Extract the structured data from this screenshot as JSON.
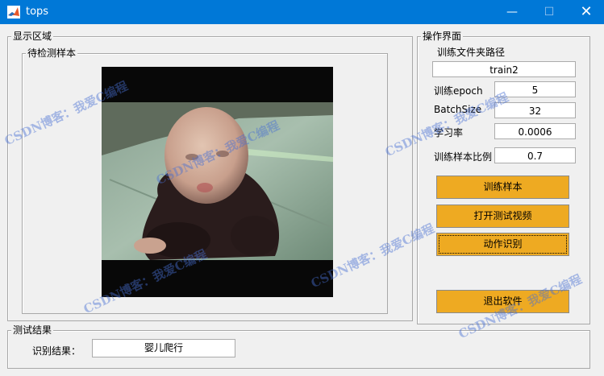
{
  "window": {
    "title": "tops",
    "minimize_glyph": "—",
    "maximize_glyph": "☐",
    "close_glyph": "✕"
  },
  "display_panel": {
    "title": "显示区域",
    "sample_panel_title": "待检测样本"
  },
  "ops_panel": {
    "title": "操作界面",
    "folder_label": "训练文件夹路径",
    "folder_value": "train2",
    "epoch_label": "训练epoch",
    "epoch_value": "5",
    "batch_label": "BatchSize",
    "batch_value": "32",
    "lr_label": "学习率",
    "lr_value": "0.0006",
    "ratio_label": "训练样本比例",
    "ratio_value": "0.7",
    "buttons": {
      "train": "训练样本",
      "open_video": "打开测试视频",
      "recognize": "动作识别",
      "exit": "退出软件"
    }
  },
  "result_panel": {
    "title": "测试结果",
    "label": "识别结果：",
    "value": "婴儿爬行"
  },
  "watermark": "CSDN博客：我爱C编程",
  "colors": {
    "titlebar": "#0078d7",
    "button": "#eeaa22",
    "background": "#f0f0f0",
    "watermark": "#466ed2"
  },
  "icons": {
    "app": "matlab-icon"
  }
}
